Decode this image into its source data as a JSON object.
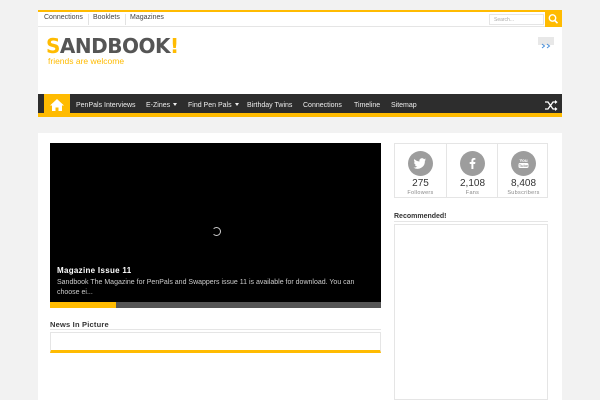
{
  "topbar": {
    "links": [
      "Connections",
      "Booklets",
      "Magazines"
    ],
    "search_placeholder": "Search..."
  },
  "header": {
    "logo_first_letter": "S",
    "logo_rest": "ANDBOOK",
    "logo_bang": "!",
    "tagline": "friends are welcome"
  },
  "nav": {
    "items": [
      {
        "label": "PenPals Interviews",
        "has_dropdown": false
      },
      {
        "label": "E-Zines",
        "has_dropdown": true
      },
      {
        "label": "Find Pen Pals",
        "has_dropdown": true
      },
      {
        "label": "Birthday Twins",
        "has_dropdown": false
      },
      {
        "label": "Connections",
        "has_dropdown": false
      },
      {
        "label": "Timeline",
        "has_dropdown": false
      },
      {
        "label": "Sitemap",
        "has_dropdown": false
      }
    ],
    "home_icon": "home-icon",
    "random_icon": "shuffle-icon"
  },
  "slider": {
    "title": "Magazine Issue 11",
    "description": "Sandbook The Magazine for PenPals and Swappers issue 11 is available for download. You can choose ei...",
    "progress": 0.2
  },
  "news_section": {
    "title": "News In Picture"
  },
  "social": [
    {
      "network": "twitter",
      "icon": "twitter-icon",
      "count": "275",
      "label": "Followers"
    },
    {
      "network": "facebook",
      "icon": "facebook-icon",
      "count": "2,108",
      "label": "Fans"
    },
    {
      "network": "youtube",
      "icon": "youtube-icon",
      "count": "8,408",
      "label": "Subscribers"
    }
  ],
  "sidebar": {
    "recommended_title": "Recommended!"
  },
  "colors": {
    "accent": "#ffbb01",
    "nav_bg": "#2d2d2d",
    "icon_grey": "#9d9d9d"
  }
}
